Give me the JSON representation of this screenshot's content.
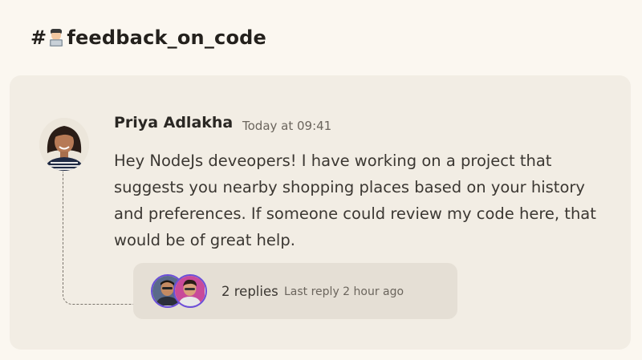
{
  "channel": {
    "prefix": "#",
    "emoji_icon": "technologist-emoji-icon",
    "name": "feedback_on_code"
  },
  "message": {
    "author": "Priya Adlakha",
    "timestamp": "Today at 09:41",
    "text": "Hey NodeJs deveopers! I have working on a project that suggests you nearby shopping places based on your history and preferences. If someone could review my code here, that would be of great help."
  },
  "thread": {
    "reply_count": "2 replies",
    "last_reply": "Last reply 2 hour ago",
    "accent_color": "#6b4fd9"
  }
}
